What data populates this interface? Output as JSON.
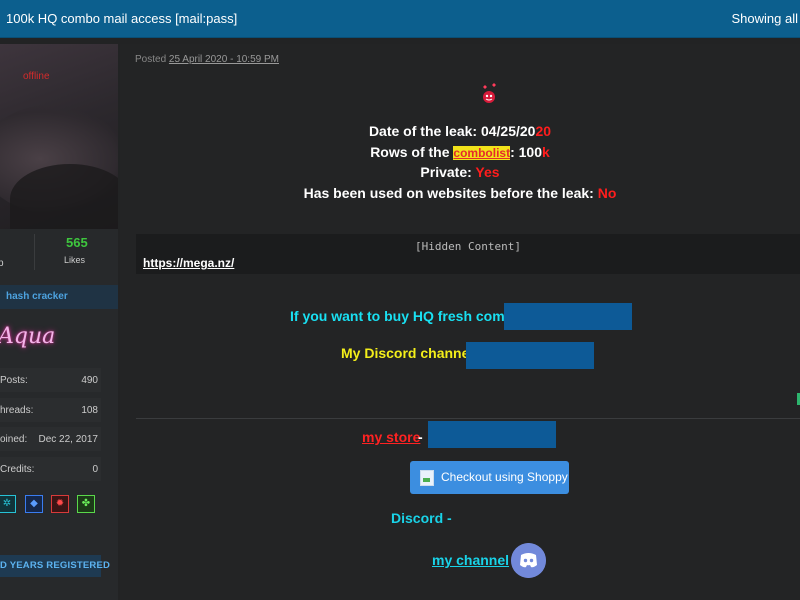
{
  "topbar": {
    "title": "100k HQ combo mail access [mail:pass]",
    "showing": "Showing all"
  },
  "profile": {
    "status": "offline",
    "likes_count": "565",
    "likes_label": "Likes",
    "left_stat_fragment": "p",
    "rank": "hash cracker",
    "userbar_text": "Aqua",
    "info": [
      {
        "key": "Posts:",
        "value": "490"
      },
      {
        "key": "hreads:",
        "value": "108"
      },
      {
        "key": "oined:",
        "value": "Dec 22, 2017"
      },
      {
        "key": "Credits:",
        "value": "0"
      }
    ],
    "badges": [
      {
        "icon": "gear-icon",
        "color": "#27c2d6"
      },
      {
        "icon": "diamond-icon",
        "color": "#3a7cf0"
      },
      {
        "icon": "bug-icon",
        "color": "#d83a3a"
      },
      {
        "icon": "clover-icon",
        "color": "#5ad84a"
      }
    ],
    "years_badge": "D YEARS REGISTERED"
  },
  "post": {
    "posted_prefix": "Posted",
    "posted_date": "25 April 2020 - 10:59 PM",
    "leak_date_label": "Date of the leak: ",
    "leak_date_white": "04/25/20",
    "leak_date_red": "20",
    "rows_label_1": "Rows of the ",
    "rows_highlight": "combolist",
    "rows_label_2": ": 100",
    "rows_red": "k",
    "private_label": "Private: ",
    "private_value": "Yes",
    "used_label": "Has been used on websites before the leak: ",
    "used_value": "No",
    "hidden_content": "[Hidden Content]",
    "link": "https://mega.nz/",
    "buy_text": "If you want to buy HQ fresh combo",
    "discord_channel_text": "My Discord channel",
    "my_store": "my store",
    "dash": "-",
    "checkout_button": "Checkout using Shoppy",
    "discord_label": "Discord -",
    "my_channel": "my channel",
    "colors": {
      "accent_cyan": "#19e0f2",
      "accent_yellow": "#f4ef1a",
      "accent_red": "#ff1d1d",
      "redaction": "#0d5a97"
    }
  }
}
